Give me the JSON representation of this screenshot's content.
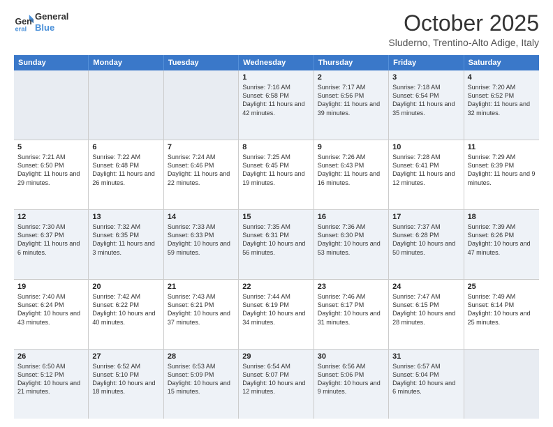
{
  "header": {
    "logo_line1": "General",
    "logo_line2": "Blue",
    "month": "October 2025",
    "location": "Sluderno, Trentino-Alto Adige, Italy"
  },
  "weekdays": [
    "Sunday",
    "Monday",
    "Tuesday",
    "Wednesday",
    "Thursday",
    "Friday",
    "Saturday"
  ],
  "rows": [
    [
      {
        "day": "",
        "sunrise": "",
        "sunset": "",
        "daylight": ""
      },
      {
        "day": "",
        "sunrise": "",
        "sunset": "",
        "daylight": ""
      },
      {
        "day": "",
        "sunrise": "",
        "sunset": "",
        "daylight": ""
      },
      {
        "day": "1",
        "sunrise": "Sunrise: 7:16 AM",
        "sunset": "Sunset: 6:58 PM",
        "daylight": "Daylight: 11 hours and 42 minutes."
      },
      {
        "day": "2",
        "sunrise": "Sunrise: 7:17 AM",
        "sunset": "Sunset: 6:56 PM",
        "daylight": "Daylight: 11 hours and 39 minutes."
      },
      {
        "day": "3",
        "sunrise": "Sunrise: 7:18 AM",
        "sunset": "Sunset: 6:54 PM",
        "daylight": "Daylight: 11 hours and 35 minutes."
      },
      {
        "day": "4",
        "sunrise": "Sunrise: 7:20 AM",
        "sunset": "Sunset: 6:52 PM",
        "daylight": "Daylight: 11 hours and 32 minutes."
      }
    ],
    [
      {
        "day": "5",
        "sunrise": "Sunrise: 7:21 AM",
        "sunset": "Sunset: 6:50 PM",
        "daylight": "Daylight: 11 hours and 29 minutes."
      },
      {
        "day": "6",
        "sunrise": "Sunrise: 7:22 AM",
        "sunset": "Sunset: 6:48 PM",
        "daylight": "Daylight: 11 hours and 26 minutes."
      },
      {
        "day": "7",
        "sunrise": "Sunrise: 7:24 AM",
        "sunset": "Sunset: 6:46 PM",
        "daylight": "Daylight: 11 hours and 22 minutes."
      },
      {
        "day": "8",
        "sunrise": "Sunrise: 7:25 AM",
        "sunset": "Sunset: 6:45 PM",
        "daylight": "Daylight: 11 hours and 19 minutes."
      },
      {
        "day": "9",
        "sunrise": "Sunrise: 7:26 AM",
        "sunset": "Sunset: 6:43 PM",
        "daylight": "Daylight: 11 hours and 16 minutes."
      },
      {
        "day": "10",
        "sunrise": "Sunrise: 7:28 AM",
        "sunset": "Sunset: 6:41 PM",
        "daylight": "Daylight: 11 hours and 12 minutes."
      },
      {
        "day": "11",
        "sunrise": "Sunrise: 7:29 AM",
        "sunset": "Sunset: 6:39 PM",
        "daylight": "Daylight: 11 hours and 9 minutes."
      }
    ],
    [
      {
        "day": "12",
        "sunrise": "Sunrise: 7:30 AM",
        "sunset": "Sunset: 6:37 PM",
        "daylight": "Daylight: 11 hours and 6 minutes."
      },
      {
        "day": "13",
        "sunrise": "Sunrise: 7:32 AM",
        "sunset": "Sunset: 6:35 PM",
        "daylight": "Daylight: 11 hours and 3 minutes."
      },
      {
        "day": "14",
        "sunrise": "Sunrise: 7:33 AM",
        "sunset": "Sunset: 6:33 PM",
        "daylight": "Daylight: 10 hours and 59 minutes."
      },
      {
        "day": "15",
        "sunrise": "Sunrise: 7:35 AM",
        "sunset": "Sunset: 6:31 PM",
        "daylight": "Daylight: 10 hours and 56 minutes."
      },
      {
        "day": "16",
        "sunrise": "Sunrise: 7:36 AM",
        "sunset": "Sunset: 6:30 PM",
        "daylight": "Daylight: 10 hours and 53 minutes."
      },
      {
        "day": "17",
        "sunrise": "Sunrise: 7:37 AM",
        "sunset": "Sunset: 6:28 PM",
        "daylight": "Daylight: 10 hours and 50 minutes."
      },
      {
        "day": "18",
        "sunrise": "Sunrise: 7:39 AM",
        "sunset": "Sunset: 6:26 PM",
        "daylight": "Daylight: 10 hours and 47 minutes."
      }
    ],
    [
      {
        "day": "19",
        "sunrise": "Sunrise: 7:40 AM",
        "sunset": "Sunset: 6:24 PM",
        "daylight": "Daylight: 10 hours and 43 minutes."
      },
      {
        "day": "20",
        "sunrise": "Sunrise: 7:42 AM",
        "sunset": "Sunset: 6:22 PM",
        "daylight": "Daylight: 10 hours and 40 minutes."
      },
      {
        "day": "21",
        "sunrise": "Sunrise: 7:43 AM",
        "sunset": "Sunset: 6:21 PM",
        "daylight": "Daylight: 10 hours and 37 minutes."
      },
      {
        "day": "22",
        "sunrise": "Sunrise: 7:44 AM",
        "sunset": "Sunset: 6:19 PM",
        "daylight": "Daylight: 10 hours and 34 minutes."
      },
      {
        "day": "23",
        "sunrise": "Sunrise: 7:46 AM",
        "sunset": "Sunset: 6:17 PM",
        "daylight": "Daylight: 10 hours and 31 minutes."
      },
      {
        "day": "24",
        "sunrise": "Sunrise: 7:47 AM",
        "sunset": "Sunset: 6:15 PM",
        "daylight": "Daylight: 10 hours and 28 minutes."
      },
      {
        "day": "25",
        "sunrise": "Sunrise: 7:49 AM",
        "sunset": "Sunset: 6:14 PM",
        "daylight": "Daylight: 10 hours and 25 minutes."
      }
    ],
    [
      {
        "day": "26",
        "sunrise": "Sunrise: 6:50 AM",
        "sunset": "Sunset: 5:12 PM",
        "daylight": "Daylight: 10 hours and 21 minutes."
      },
      {
        "day": "27",
        "sunrise": "Sunrise: 6:52 AM",
        "sunset": "Sunset: 5:10 PM",
        "daylight": "Daylight: 10 hours and 18 minutes."
      },
      {
        "day": "28",
        "sunrise": "Sunrise: 6:53 AM",
        "sunset": "Sunset: 5:09 PM",
        "daylight": "Daylight: 10 hours and 15 minutes."
      },
      {
        "day": "29",
        "sunrise": "Sunrise: 6:54 AM",
        "sunset": "Sunset: 5:07 PM",
        "daylight": "Daylight: 10 hours and 12 minutes."
      },
      {
        "day": "30",
        "sunrise": "Sunrise: 6:56 AM",
        "sunset": "Sunset: 5:06 PM",
        "daylight": "Daylight: 10 hours and 9 minutes."
      },
      {
        "day": "31",
        "sunrise": "Sunrise: 6:57 AM",
        "sunset": "Sunset: 5:04 PM",
        "daylight": "Daylight: 10 hours and 6 minutes."
      },
      {
        "day": "",
        "sunrise": "",
        "sunset": "",
        "daylight": ""
      }
    ]
  ]
}
